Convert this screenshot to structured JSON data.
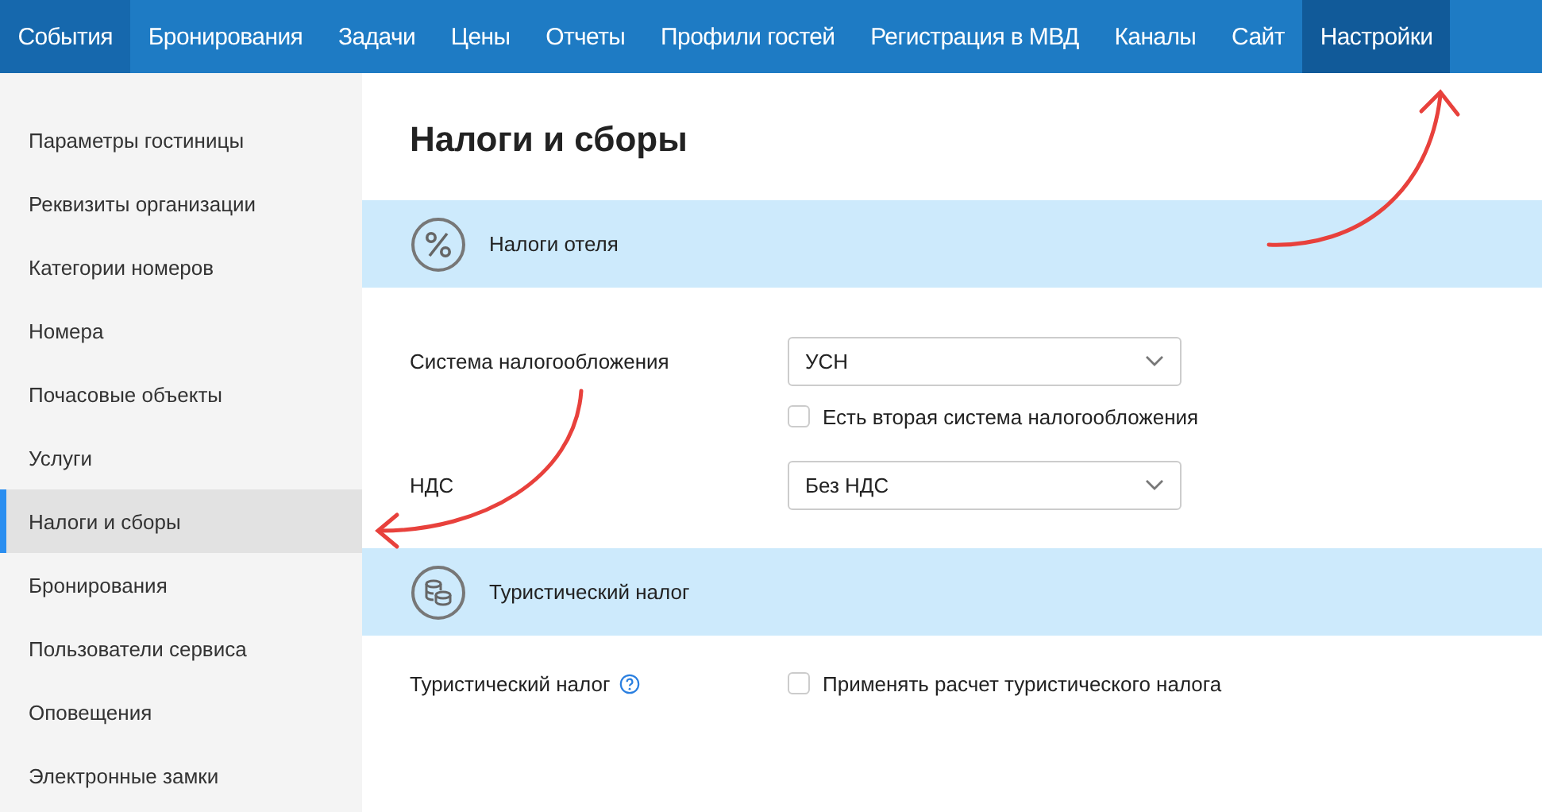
{
  "top_nav": [
    {
      "label": "События",
      "selected": false,
      "hovered": true
    },
    {
      "label": "Бронирования",
      "selected": false,
      "hovered": false
    },
    {
      "label": "Задачи",
      "selected": false,
      "hovered": false
    },
    {
      "label": "Цены",
      "selected": false,
      "hovered": false
    },
    {
      "label": "Отчеты",
      "selected": false,
      "hovered": false
    },
    {
      "label": "Профили гостей",
      "selected": false,
      "hovered": false
    },
    {
      "label": "Регистрация в МВД",
      "selected": false,
      "hovered": false
    },
    {
      "label": "Каналы",
      "selected": false,
      "hovered": false
    },
    {
      "label": "Сайт",
      "selected": false,
      "hovered": false
    },
    {
      "label": "Настройки",
      "selected": true,
      "hovered": false
    }
  ],
  "sidebar": {
    "items": [
      {
        "label": "Параметры гостиницы",
        "selected": false
      },
      {
        "label": "Реквизиты организации",
        "selected": false
      },
      {
        "label": "Категории номеров",
        "selected": false
      },
      {
        "label": "Номера",
        "selected": false
      },
      {
        "label": "Почасовые объекты",
        "selected": false
      },
      {
        "label": "Услуги",
        "selected": false
      },
      {
        "label": "Налоги и сборы",
        "selected": true
      },
      {
        "label": "Бронирования",
        "selected": false
      },
      {
        "label": "Пользователи сервиса",
        "selected": false
      },
      {
        "label": "Оповещения",
        "selected": false
      },
      {
        "label": "Электронные замки",
        "selected": false
      }
    ]
  },
  "page_title": "Налоги и сборы",
  "sections": [
    {
      "title": "Налоги отеля",
      "rows": [
        {
          "kind": "select",
          "label": "Система налогообложения",
          "value": "УСН",
          "help": false
        },
        {
          "kind": "checkbox",
          "label": "Есть вторая система налогообложения",
          "checked": false
        },
        {
          "kind": "select",
          "label": "НДС",
          "value": "Без НДС",
          "help": false
        }
      ]
    },
    {
      "title": "Туристический налог",
      "rows": [
        {
          "kind": "checkbox-field",
          "label": "Туристический налог",
          "help": true,
          "option": "Применять расчет туристического налога",
          "checked": false
        }
      ]
    }
  ],
  "annotations": [
    {
      "kind": "arrow-up-right"
    },
    {
      "kind": "arrow-down-left"
    }
  ]
}
